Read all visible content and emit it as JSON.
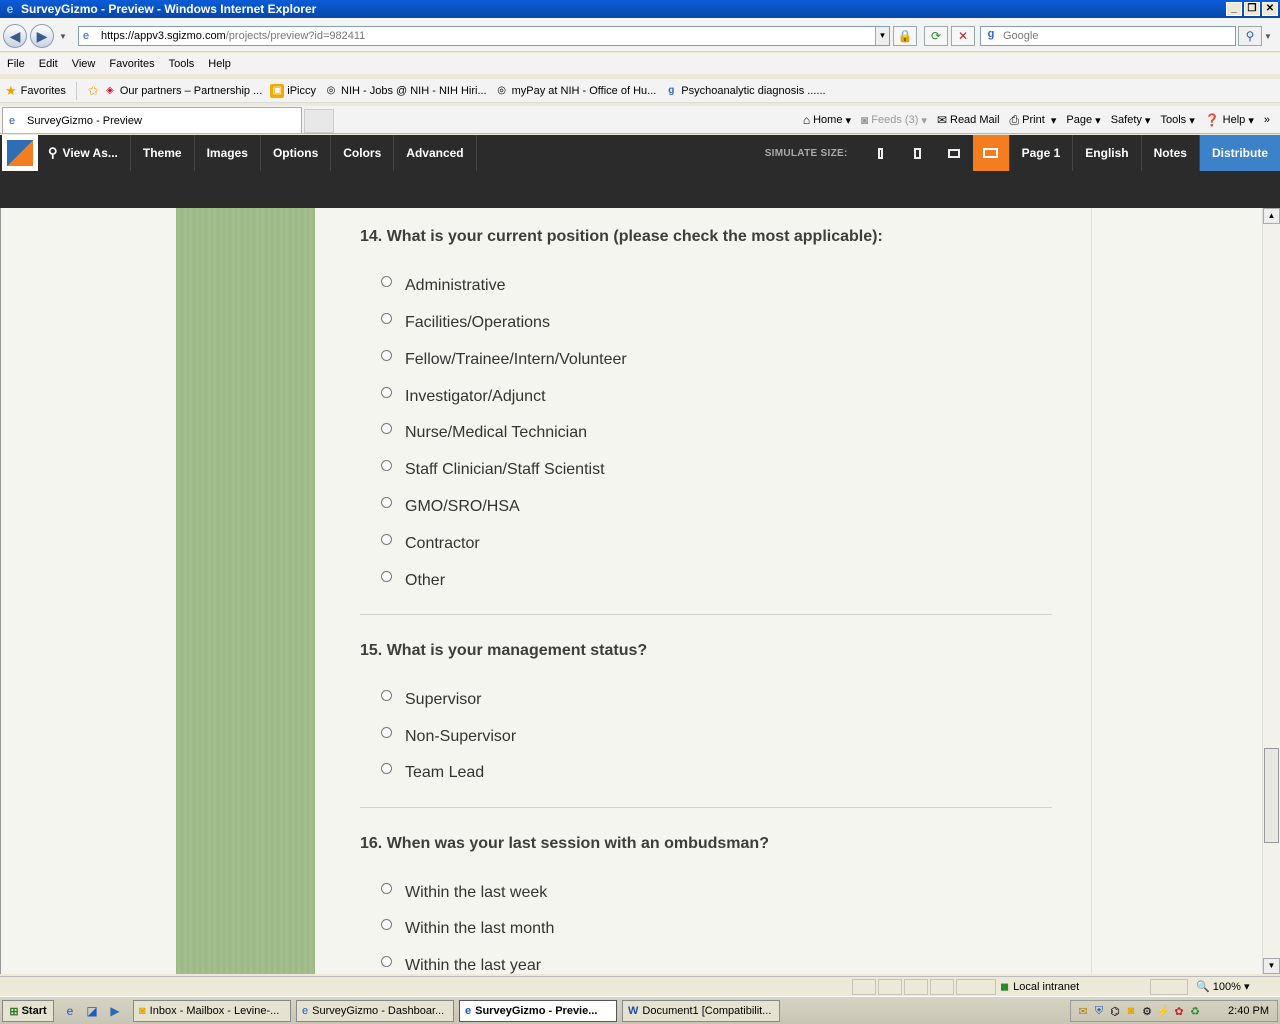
{
  "window": {
    "title": "SurveyGizmo - Preview - Windows Internet Explorer",
    "buttons": [
      "_",
      "❐",
      "✕"
    ]
  },
  "address": {
    "url_main": "https://appv3.sgizmo.com",
    "url_rest": "/projects/preview?id=982411",
    "search_placeholder": "Google"
  },
  "menu": [
    "File",
    "Edit",
    "View",
    "Favorites",
    "Tools",
    "Help"
  ],
  "favorites": {
    "label": "Favorites",
    "items": [
      {
        "label": "Our partners – Partnership ...",
        "icon": "globe-icon",
        "color": "#c8102e"
      },
      {
        "label": "iPiccy",
        "icon": "photo-icon",
        "color": "#f2a900"
      },
      {
        "label": "NIH - Jobs @ NIH - NIH Hiri...",
        "icon": "page-icon",
        "color": "#555555"
      },
      {
        "label": "myPay at NIH - Office of Hu...",
        "icon": "page-icon",
        "color": "#555555"
      },
      {
        "label": "Psychoanalytic diagnosis ......",
        "icon": "google-icon",
        "color": "#3367d6"
      }
    ]
  },
  "tab": {
    "label": "SurveyGizmo - Preview"
  },
  "commandbar": {
    "home": "Home",
    "feeds": "Feeds (3)",
    "read_mail": "Read Mail",
    "print": "Print",
    "page": "Page",
    "safety": "Safety",
    "tools": "Tools",
    "help": "Help"
  },
  "sgtoolbar": {
    "view_as": "View As...",
    "theme": "Theme",
    "images": "Images",
    "options": "Options",
    "colors": "Colors",
    "advanced": "Advanced",
    "simulate_size": "SIMULATE SIZE:",
    "page": "Page 1",
    "language": "English",
    "notes": "Notes",
    "distribute": "Distribute",
    "accent": "#f47d20",
    "distribute_color": "#3c82c8"
  },
  "survey": {
    "q14": {
      "title": "14. What is your current position (please check the most applicable):",
      "options": [
        "Administrative",
        "Facilities/Operations",
        "Fellow/Trainee/Intern/Volunteer",
        "Investigator/Adjunct",
        "Nurse/Medical Technician",
        "Staff Clinician/Staff Scientist",
        "GMO/SRO/HSA",
        "Contractor",
        "Other"
      ]
    },
    "q15": {
      "title": "15. What is your management status?",
      "options": [
        "Supervisor",
        "Non-Supervisor",
        "Team Lead"
      ]
    },
    "q16": {
      "title": "16. When was your last session with an ombudsman?",
      "options": [
        "Within the last week",
        "Within the last month",
        "Within the last year"
      ]
    }
  },
  "statusbar": {
    "zone": "Local intranet",
    "zoom": "100%"
  },
  "taskbar": {
    "start": "Start",
    "buttons": [
      "Inbox - Mailbox - Levine-...",
      "SurveyGizmo - Dashboar...",
      "SurveyGizmo - Previe...",
      "Document1 [Compatibilit..."
    ],
    "clock": "2:40 PM"
  }
}
